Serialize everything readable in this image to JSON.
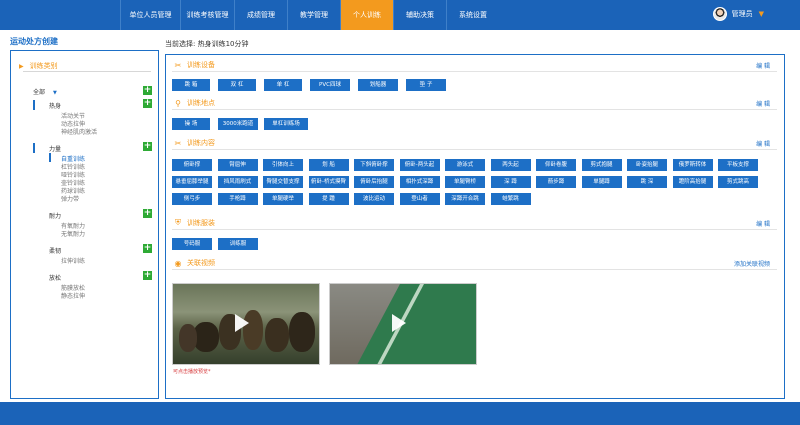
{
  "nav": {
    "items": [
      "单位人员管理",
      "训练考核管理",
      "成绩管理",
      "教学管理",
      "个人训练",
      "辅助决策",
      "系统设置"
    ],
    "active_index": 4
  },
  "user": {
    "name": "管理员",
    "caret": "▼"
  },
  "left": {
    "title": "运动处方创建",
    "header": "训练类别",
    "all_label": "全部",
    "dropdown_glyph": "▼",
    "groups": [
      {
        "label": "热身",
        "items": [
          "活动关节",
          "动态拉伸",
          "神经肌肉激活"
        ]
      },
      {
        "label": "力量",
        "items": [
          "自重训练",
          "杠铃训练",
          "哑铃训练",
          "壶铃训练",
          "药球训练",
          "弹力带"
        ]
      },
      {
        "label": "耐力",
        "items": [
          "有氧耐力",
          "无氧耐力"
        ]
      },
      {
        "label": "柔韧",
        "items": [
          "拉伸训练"
        ]
      },
      {
        "label": "放松",
        "items": [
          "筋膜放松",
          "静态拉伸"
        ]
      }
    ],
    "selected": "自重训练"
  },
  "right": {
    "current_prefix": "当前选择:",
    "current_value": "热身训练10分钟",
    "edit_label": "编 辑",
    "sections": {
      "equipment": {
        "title": "训练设备",
        "items": [
          "跳 箱",
          "双 杠",
          "单 杠",
          "PVC四球",
          "划船器",
          "垫 子"
        ]
      },
      "location": {
        "title": "训练地点",
        "items": [
          "操 场",
          "3000米跑道",
          "单杠训练场"
        ]
      },
      "content": {
        "title": "训练内容",
        "items": [
          "俯卧撑",
          "臂屈伸",
          "引体向上",
          "划 船",
          "下斜俯卧撑",
          "俯卧-两头起",
          "游泳式",
          "两头起",
          "仰卧卷腹",
          "剪式抱腿",
          "卧姿抬腿",
          "俄罗斯转体",
          "平板支撑",
          "悬垂屈膝举腿",
          "挡风雨刷式",
          "臀腿交替支撑",
          "俯卧-桥式摸臀",
          "俯卧后抬腿",
          "相扑式深蹲",
          "单腿臀桥",
          "深 蹲",
          "箭步蹲",
          "单腿蹲",
          "跳 深",
          "蹬阶高抬腿",
          "剪式跳高",
          "侧弓步",
          "手枪蹲",
          "单腿硬举",
          "提 踵",
          "波比运动",
          "登山者",
          "深蹲开合跳",
          "蛙繁跳"
        ]
      },
      "clothing": {
        "title": "训练服装",
        "items": [
          "号码服",
          "训练服"
        ]
      },
      "video": {
        "title": "关联视频",
        "add_label": "添加关联视频",
        "note": "可点击播放预览*"
      }
    }
  },
  "colors": {
    "brand": "#1d6fc6",
    "accent": "#f39a1e",
    "add": "#2eaa35",
    "note": "#d6383a"
  }
}
